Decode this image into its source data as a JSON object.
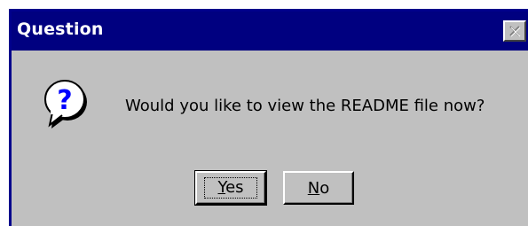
{
  "dialog": {
    "title": "Question",
    "message": "Would you like to view the README file now?",
    "icon": "question-icon",
    "close_icon": "close-icon",
    "buttons": [
      {
        "label_mnemonic": "Y",
        "label_rest": "es",
        "label": "Yes",
        "focused": true
      },
      {
        "label_mnemonic": "N",
        "label_rest": "o",
        "label": "No",
        "focused": false
      }
    ]
  },
  "colors": {
    "titlebar": "#000080",
    "face": "#c0c0c0",
    "icon_blue": "#0000ff"
  }
}
